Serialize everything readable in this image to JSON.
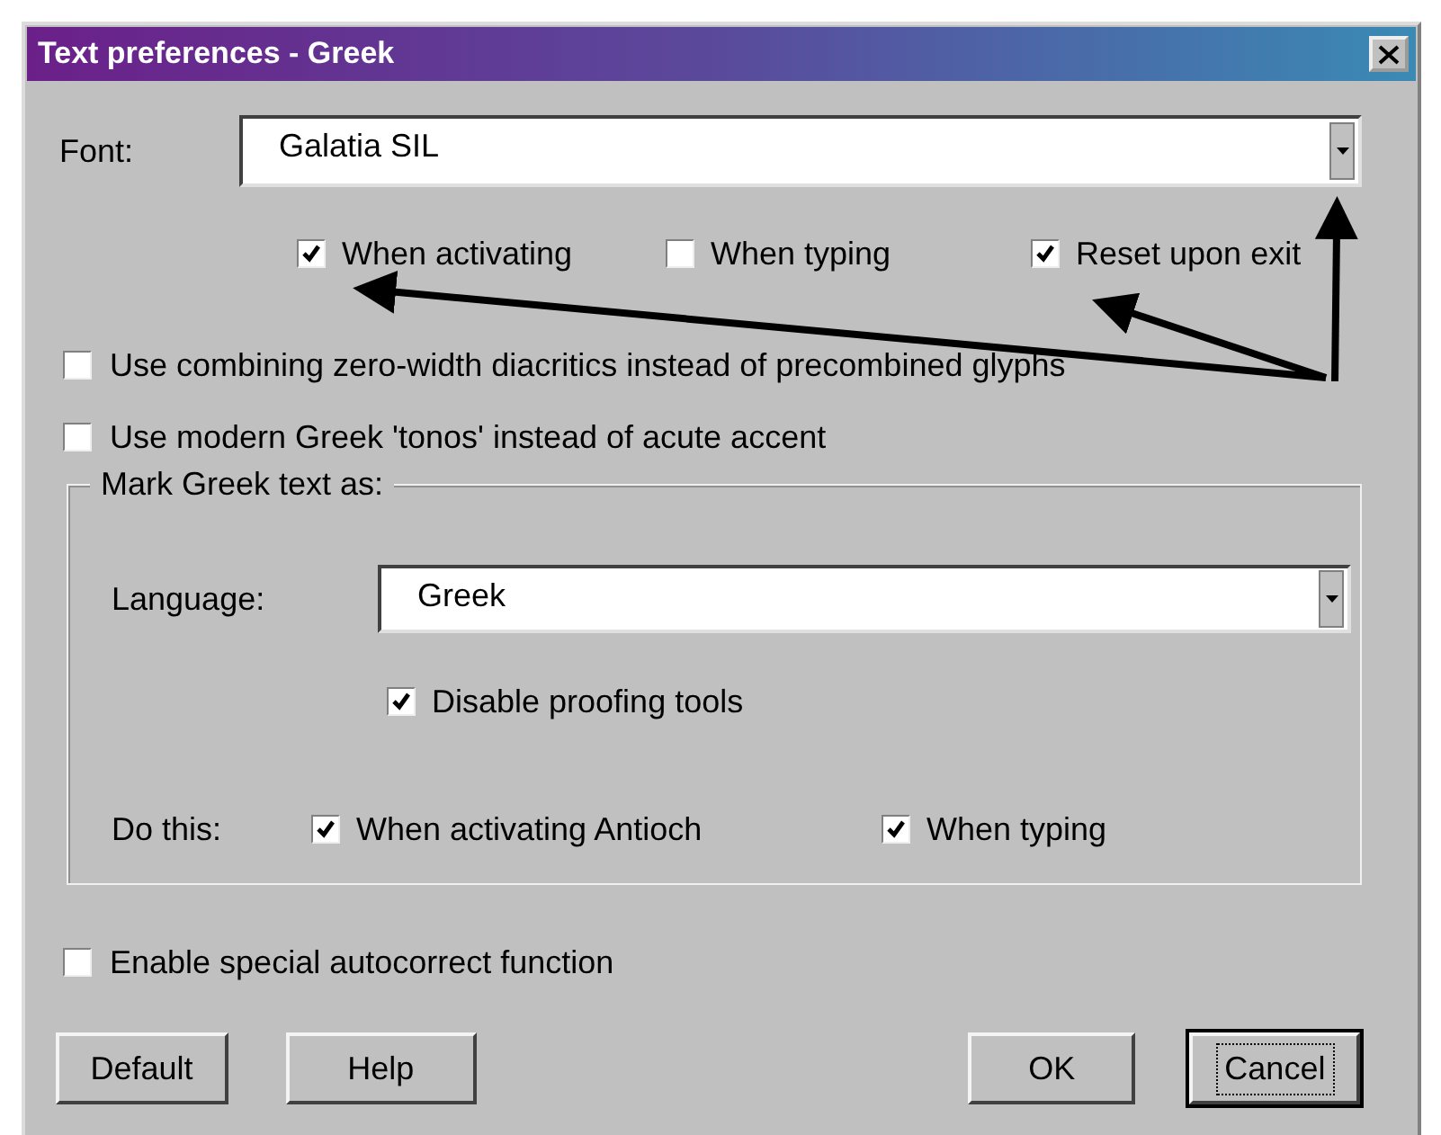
{
  "window": {
    "title": "Text preferences - Greek"
  },
  "font": {
    "label": "Font:",
    "value": "Galatia SIL"
  },
  "font_options": [
    {
      "label": "When activating",
      "checked": true
    },
    {
      "label": "When typing",
      "checked": false
    },
    {
      "label": "Reset upon exit",
      "checked": true
    }
  ],
  "options": [
    {
      "label": "Use combining zero-width diacritics instead of precombined glyphs",
      "checked": false
    },
    {
      "label": "Use modern Greek 'tonos' instead of acute accent",
      "checked": false
    }
  ],
  "group": {
    "title": "Mark Greek text as:",
    "language": {
      "label": "Language:",
      "value": "Greek"
    },
    "proofing": {
      "label": "Disable proofing tools",
      "checked": true
    },
    "do_this": {
      "label": "Do this:",
      "options": [
        {
          "label": "When activating Antioch",
          "checked": true
        },
        {
          "label": "When typing",
          "checked": true
        }
      ]
    }
  },
  "autocorrect": {
    "label": "Enable special autocorrect function",
    "checked": false
  },
  "buttons": [
    {
      "label": "Default",
      "focused": false
    },
    {
      "label": "Help",
      "focused": false
    },
    {
      "label": "OK",
      "focused": false
    },
    {
      "label": "Cancel",
      "focused": true
    }
  ]
}
